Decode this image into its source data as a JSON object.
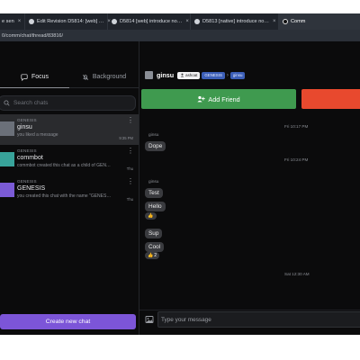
{
  "browser": {
    "tabs": [
      {
        "label": "e sen"
      },
      {
        "label": "Edit Revision D5814: [web] …"
      },
      {
        "label": "D5814 [web] introduce no…"
      },
      {
        "label": "D5813 [native] introduce no…"
      },
      {
        "label": "Comm"
      }
    ],
    "close_glyph": "×",
    "url": "0/comm/chat/thread/83816/"
  },
  "sidebar": {
    "tabs": [
      {
        "label": "Focus",
        "icon": "chat-bubble-icon"
      },
      {
        "label": "Background",
        "icon": "bell-off-icon"
      }
    ],
    "search_placeholder": "Search chats",
    "chats": [
      {
        "org": "GENESIS",
        "name": "ginsu",
        "preview": "you liked a message",
        "time": "9:35 PM",
        "avatar_color": "#6b7079",
        "selected": true
      },
      {
        "org": "GENESIS",
        "name": "commbot",
        "preview": "commbot created this chat as a child of GEN…",
        "time": "Thu",
        "avatar_color": "#38a39a",
        "selected": false
      },
      {
        "org": "GENESIS",
        "name": "GENESIS",
        "preview": "you created this chat with the name \"GENES…",
        "time": "Thu",
        "avatar_color": "#7b5bd6",
        "selected": false
      }
    ],
    "new_chat_label": "Create new chat"
  },
  "thread": {
    "header": {
      "name": "ginsu",
      "user_chip": "ashoat",
      "org_chip": "GENESIS",
      "separator": "›",
      "current_chip": "ginsu"
    },
    "add_friend_label": "Add Friend",
    "timeline": [
      {
        "kind": "time",
        "text": "Fri 10:17 PM"
      },
      {
        "kind": "sender",
        "text": "ginsu"
      },
      {
        "kind": "msg",
        "text": "Dope"
      },
      {
        "kind": "time",
        "text": "Fri 10:24 PM"
      },
      {
        "kind": "sender",
        "text": "ginsu"
      },
      {
        "kind": "msg",
        "text": "Test"
      },
      {
        "kind": "msg",
        "text": "Hello"
      },
      {
        "kind": "reaction",
        "emoji": "👍",
        "count": ""
      },
      {
        "kind": "msg",
        "text": "Sup"
      },
      {
        "kind": "msg",
        "text": "Cool"
      },
      {
        "kind": "reaction",
        "emoji": "👍",
        "count": "2"
      },
      {
        "kind": "time",
        "text": "Sat 12:30 AM"
      }
    ],
    "composer_placeholder": "Type your message"
  },
  "colors": {
    "accent_purple": "#7c55d8",
    "add_friend_green": "#3f9a4f",
    "block_red": "#e8492e",
    "background": "#0b0b0c"
  }
}
